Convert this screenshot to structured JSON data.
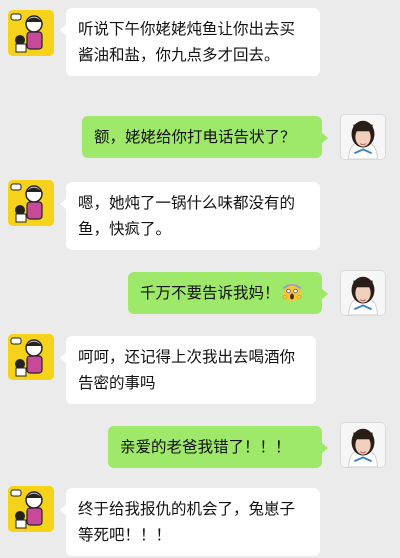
{
  "messages": [
    {
      "side": "left",
      "sender": "dad",
      "text": "听说下午你姥姥炖鱼让你出去买酱油和盐，你九点多才回去。"
    },
    {
      "side": "right",
      "sender": "girl",
      "text": "额，姥姥给你打电话告状了？"
    },
    {
      "side": "left",
      "sender": "dad",
      "text": "嗯，她炖了一锅什么味都没有的鱼，快疯了。"
    },
    {
      "side": "right",
      "sender": "girl",
      "text": "千万不要告诉我妈！",
      "trailing_icon": "face-screaming-in-fear-icon"
    },
    {
      "side": "left",
      "sender": "dad",
      "text": "呵呵，还记得上次我出去喝酒你告密的事吗"
    },
    {
      "side": "right",
      "sender": "girl",
      "text": "亲爱的老爸我错了！！！"
    },
    {
      "side": "left",
      "sender": "dad",
      "text": "终于给我报仇的机会了，兔崽子等死吧！！！"
    }
  ],
  "colors": {
    "background": "#ebebeb",
    "left_bubble": "#ffffff",
    "right_bubble": "#9ee86a",
    "dad_avatar_bg": "#f7d21a"
  }
}
